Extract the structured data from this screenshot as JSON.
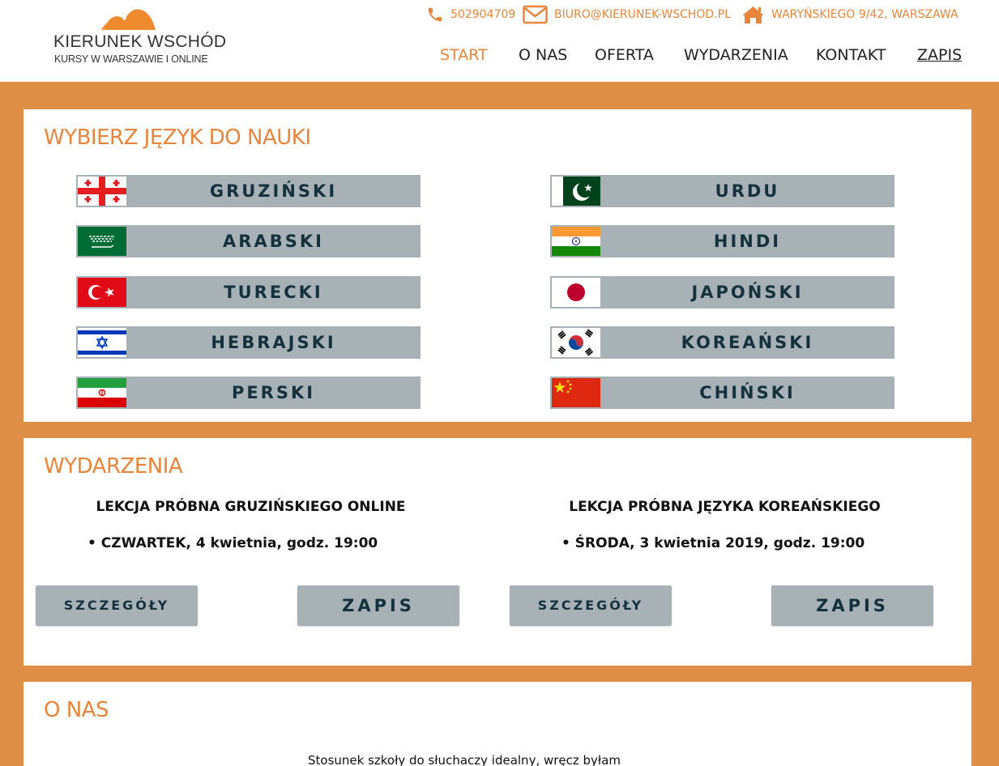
{
  "header": {
    "logo_title": "KIERUNEK WSCHÓD",
    "logo_subtitle": "KURSY W WARSZAWIE I ONLINE",
    "phone": "502904709",
    "email": "BIURO@KIERUNEK-WSCHOD.PL",
    "address": "WARYŃSKIEGO 9/42, WARSZAWA",
    "nav": [
      "START",
      "O NAS",
      "OFERTA",
      "WYDARZENIA",
      "KONTAKT",
      "ZAPIS"
    ],
    "nav_active": "START",
    "accent_color": "#e7853a"
  },
  "languages": {
    "title": "WYBIERZ JĘZYK DO NAUKI",
    "items": [
      {
        "label": "GRUZIŃSKI",
        "flag": "georgia-flag-icon"
      },
      {
        "label": "URDU",
        "flag": "pakistan-flag-icon"
      },
      {
        "label": "ARABSKI",
        "flag": "saudi-arabia-flag-icon"
      },
      {
        "label": "HINDI",
        "flag": "india-flag-icon"
      },
      {
        "label": "TURECKI",
        "flag": "turkey-flag-icon"
      },
      {
        "label": "JAPOŃSKI",
        "flag": "japan-flag-icon"
      },
      {
        "label": "HEBRAJSKI",
        "flag": "israel-flag-icon"
      },
      {
        "label": "KOREAŃSKI",
        "flag": "south-korea-flag-icon"
      },
      {
        "label": "PERSKI",
        "flag": "iran-flag-icon"
      },
      {
        "label": "CHIŃSKI",
        "flag": "china-flag-icon"
      }
    ]
  },
  "events": {
    "title": "WYDARZENIA",
    "items": [
      {
        "title": "LEKCJA PRÓBNA GRUZIŃSKIEGO ONLINE",
        "date": "CZWARTEK, 4 kwietnia, godz. 19:00",
        "details_label": "SZCZEGÓŁY",
        "signup_label": "ZAPIS"
      },
      {
        "title": "LEKCJA PRÓBNA JĘZYKA KOREAŃSKIEGO",
        "date": "ŚRODA, 3 kwietnia 2019, godz. 19:00",
        "details_label": "SZCZEGÓŁY",
        "signup_label": "ZAPIS"
      }
    ]
  },
  "about": {
    "title": "O NAS",
    "text": "Stosunek szkoły do słuchaczy idealny, wręcz byłam"
  },
  "colors": {
    "background": "#de8f45",
    "button": "#a8b2b6",
    "button_text": "#14323d"
  }
}
